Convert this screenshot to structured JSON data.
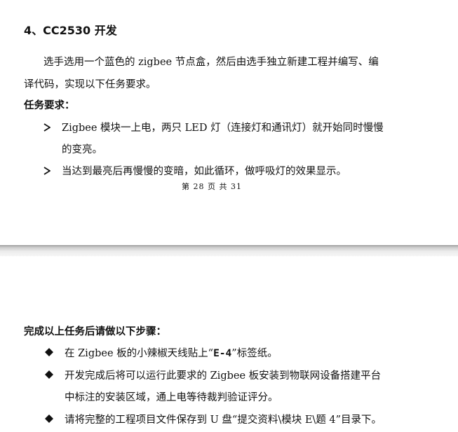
{
  "page1": {
    "heading": "4、CC2530 开发",
    "intro_line1": "选手选用一个蓝色的 zigbee 节点盒，然后由选手独立新建工程并编写、编",
    "intro_line2": "译代码，实现以下任务要求。",
    "task_label": "任务要求：",
    "bullets": [
      {
        "line1": "Zigbee 模块一上电，两只 LED 灯（连接灯和通讯灯）就开始同时慢慢",
        "line2": "的变亮。"
      },
      {
        "line1": "当达到最亮后再慢慢的变暗，如此循环，做呼吸灯的效果显示。"
      }
    ],
    "footer": "第 28 页 共 31"
  },
  "page2": {
    "steps_label": "完成以上任务后请做以下步骤：",
    "steps": [
      {
        "pre": "在 Zigbee 板的小辣椒天线贴上“",
        "bold": "E-4",
        "post": "”标签纸。"
      },
      {
        "line1": "开发完成后将可以运行此要求的 Zigbee 板安装到物联网设备搭建平台",
        "line2": "中标注的安装区域，通上电等待裁判验证评分。"
      },
      {
        "line1": "请将完整的工程项目文件保存到 U 盘“提交资料\\模块 E\\题 4”目录下。"
      }
    ]
  }
}
